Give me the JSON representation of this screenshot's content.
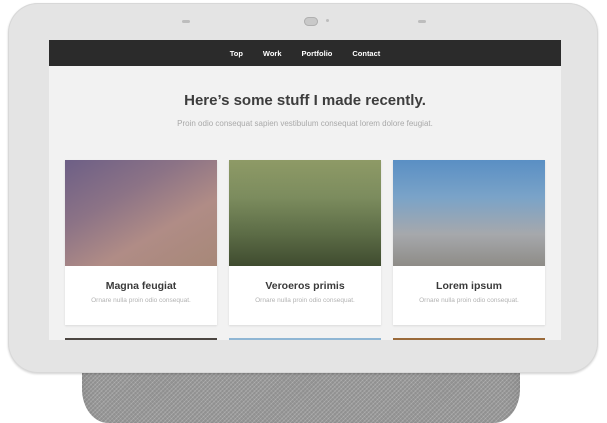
{
  "nav": {
    "items": [
      {
        "label": "Top"
      },
      {
        "label": "Work"
      },
      {
        "label": "Portfolio"
      },
      {
        "label": "Contact"
      }
    ]
  },
  "hero": {
    "title": "Here’s some stuff I made recently.",
    "subtitle": "Proin odio consequat sapien vestibulum consequat lorem dolore feugiat."
  },
  "cards": [
    {
      "title": "Magna feugiat",
      "description": "Ornare nulla proin odio consequat."
    },
    {
      "title": "Veroeros primis",
      "description": "Ornare nulla proin odio consequat."
    },
    {
      "title": "Lorem ipsum",
      "description": "Ornare nulla proin odio consequat."
    }
  ],
  "colors": {
    "navbar": "#2b2b2b",
    "page_background": "#f2f2f2",
    "device_frame": "#e4e4e4"
  }
}
